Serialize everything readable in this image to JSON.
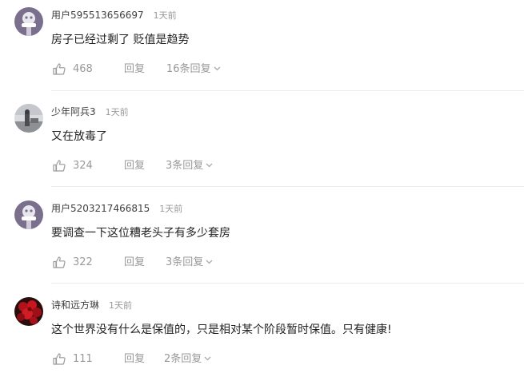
{
  "comments": [
    {
      "username": "用户595513656697",
      "time": "1天前",
      "text": "房子已经过剩了 贬值是趋势",
      "likes": "468",
      "reply_label": "回复",
      "replies_label": "16条回复"
    },
    {
      "username": "少年阿兵3",
      "time": "1天前",
      "text": "又在放毒了",
      "likes": "324",
      "reply_label": "回复",
      "replies_label": "3条回复"
    },
    {
      "username": "用户5203217466815",
      "time": "1天前",
      "text": "要调查一下这位糟老头子有多少套房",
      "likes": "322",
      "reply_label": "回复",
      "replies_label": "3条回复"
    },
    {
      "username": "诗和远方琳",
      "time": "1天前",
      "text": "这个世界没有什么是保值的，只是相对某个阶段暂时保值。只有健康!",
      "likes": "111",
      "reply_label": "回复",
      "replies_label": "2条回复"
    }
  ],
  "icons": {
    "like": "thumbs-up-icon",
    "expand": "chevron-down-icon"
  },
  "colors": {
    "default_avatar_bg": "#7b6f8e",
    "muted_text": "#999999"
  }
}
